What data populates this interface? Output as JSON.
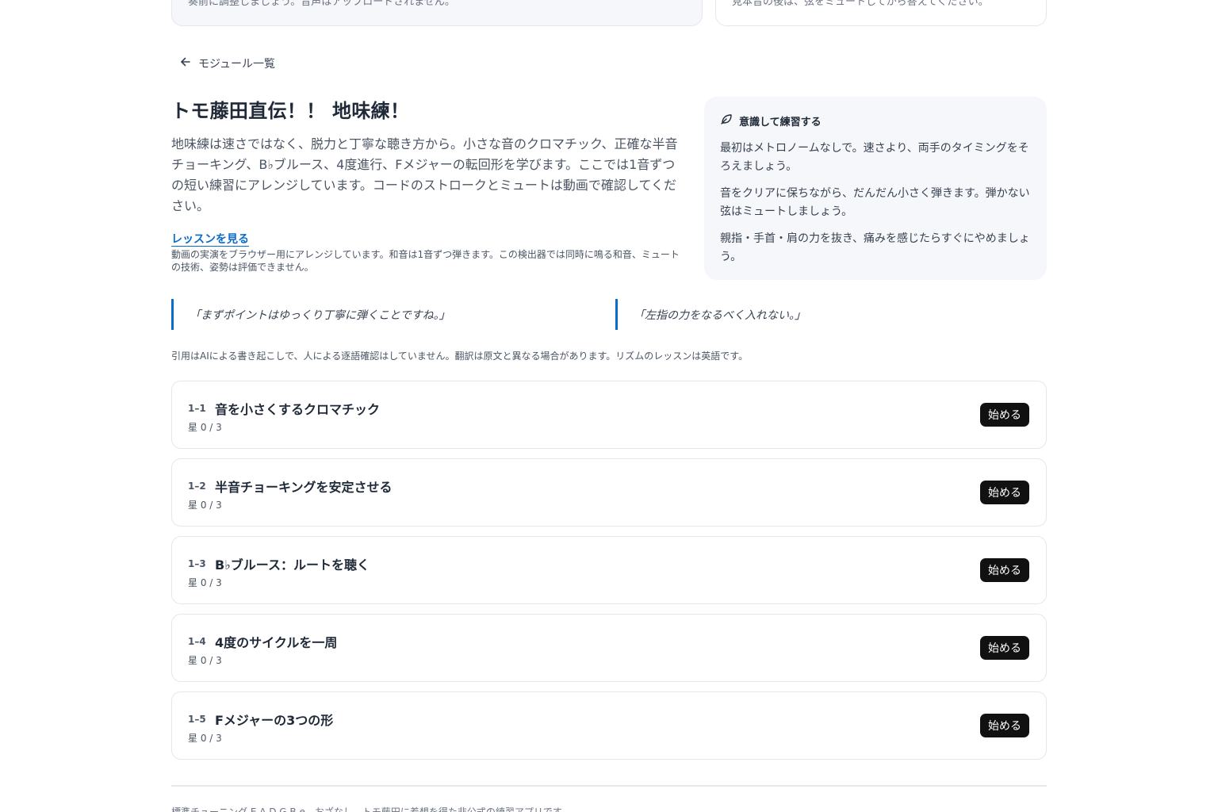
{
  "top_cards": {
    "left_text": "奏前に調整しましょう。音声はアップロードされません。",
    "right_text": "見本音の後は、弦をミュートしてから答えてください。"
  },
  "nav": {
    "back_label": "モジュール一覧",
    "back_icon": "arrow-left-icon"
  },
  "module": {
    "title": "トモ藤田直伝！！ 地味練！",
    "description": "地味練は速さではなく、脱力と丁寧な聴き方から。小さな音のクロマチック、正確な半音チョーキング、B♭ブルース、4度進行、Fメジャーの転回形を学びます。ここでは1音ずつの短い練習にアレンジしています。コードのストロークとミュートは動画で確認してください。",
    "lesson_link": "レッスンを見る",
    "lesson_note": "動画の実演をブラウザー用にアレンジしています。和音は1音ずつ弾きます。この検出器では同時に鳴る和音、ミュートの技術、姿勢は評価できません。"
  },
  "tips": {
    "heading": "意識して練習する",
    "icon": "leaf-icon",
    "items": [
      "最初はメトロノームなしで。速さより、両手のタイミングをそろえましょう。",
      "音をクリアに保ちながら、だんだん小さく弾きます。弾かない弦はミュートしましょう。",
      "親指・手首・肩の力を抜き、痛みを感じたらすぐにやめましょう。"
    ]
  },
  "quotes": [
    "「まずポイントはゆっくり丁寧に弾くことですね。」",
    "「左指の力をなるべく入れない。」"
  ],
  "quote_note": "引用はAIによる書き起こしで、人による逐語確認はしていません。翻訳は原文と異なる場合があります。リズムのレッスンは英語です。",
  "exercises": [
    {
      "num": "1–1",
      "title": "音を小さくするクロマチック",
      "stars": "星 0 / 3",
      "button": "始める"
    },
    {
      "num": "1–2",
      "title": "半音チョーキングを安定させる",
      "stars": "星 0 / 3",
      "button": "始める"
    },
    {
      "num": "1–3",
      "title": "B♭ブルース：ルートを聴く",
      "stars": "星 0 / 3",
      "button": "始める"
    },
    {
      "num": "1–4",
      "title": "4度のサイクルを一周",
      "stars": "星 0 / 3",
      "button": "始める"
    },
    {
      "num": "1–5",
      "title": "Fメジャーの3つの形",
      "stars": "星 0 / 3",
      "button": "始める"
    }
  ],
  "footer": "標準チューニング E A D G B e。おざなし、トモ藤田に着想を得た非公式の練習アプリです。",
  "colors": {
    "accent": "#0b6bcb",
    "button_bg": "#111111",
    "panel_bg": "#f5f7fa"
  }
}
